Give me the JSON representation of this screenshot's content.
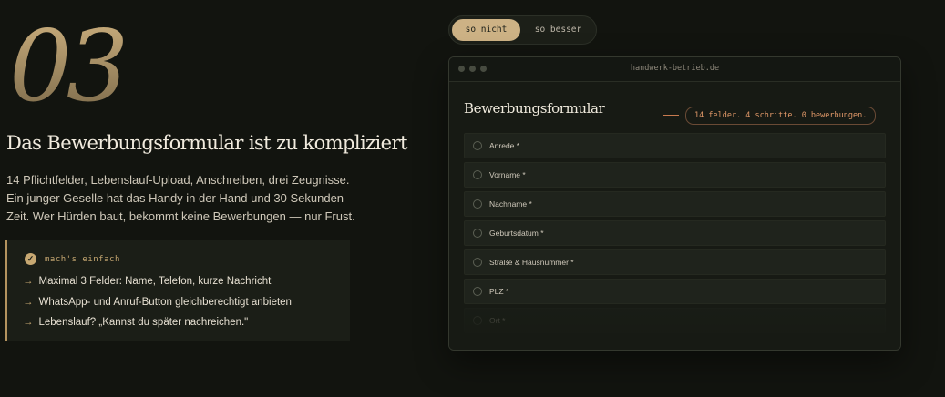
{
  "section": {
    "number": "03",
    "title": "Das Bewerbungsformular ist zu kompliziert",
    "description": "14 Pflichtfelder, Lebenslauf-Upload, Anschreiben, drei Zeugnisse. Ein junger Geselle hat das Handy in der Hand und 30 Sekunden Zeit. Wer Hürden baut, bekommt keine Bewerbungen — nur Frust."
  },
  "tip": {
    "label": "mach's einfach",
    "icon": "check-icon",
    "items": [
      "Maximal 3 Felder: Name, Telefon, kurze Nachricht",
      "WhatsApp- und Anruf-Button gleichberechtigt anbieten",
      "Lebenslauf? „Kannst du später nachreichen.\""
    ]
  },
  "toggle": {
    "active": "so nicht",
    "inactive": "so besser"
  },
  "browser": {
    "url": "handwerk-betrieb.de",
    "form_title": "Bewerbungsformular",
    "warning": "14 felder. 4 schritte. 0 bewerbungen.",
    "fields": [
      "Anrede *",
      "Vorname *",
      "Nachname *",
      "Geburtsdatum *",
      "Straße & Hausnummer *",
      "PLZ *",
      "Ort *"
    ]
  },
  "colors": {
    "background": "#12140f",
    "accent": "#c7a872",
    "warning": "#e09868"
  }
}
